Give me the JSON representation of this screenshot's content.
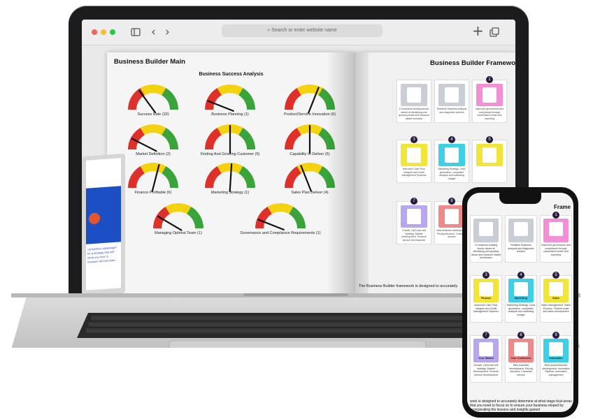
{
  "browser": {
    "url_placeholder": "Search or enter website name",
    "icons": [
      "sidebar-icon",
      "back-icon",
      "forward-icon",
      "new-tab-icon",
      "tabs-icon"
    ],
    "traffic_lights": [
      "#ff5f57",
      "#febc2e",
      "#28c840"
    ]
  },
  "left_page": {
    "title": "Business Builder Main",
    "subtitle": "Business Success Analysis",
    "gauges": [
      {
        "label": "Success Rate (32)",
        "level": 0.3
      },
      {
        "label": "Business Planning (1)",
        "level": 0.12
      },
      {
        "label": "Product/Service Innovation (6)",
        "level": 0.62
      },
      {
        "label": "Market Definition (2)",
        "level": 0.15
      },
      {
        "label": "Finding And Growing Customer (5)",
        "level": 0.5
      },
      {
        "label": "Capability to Deliver (5)",
        "level": 0.5
      },
      {
        "label": "Finance Profitable (6)",
        "level": 0.58
      },
      {
        "label": "Marketing Strategy (1)",
        "level": 0.52
      },
      {
        "label": "Sales Plan Deliver (4)",
        "level": 0.38
      },
      {
        "label": "Managing Optimal Team (1)",
        "level": 0.17
      },
      {
        "label": "Governance and Compliance Requirements (1)",
        "level": 0.12
      }
    ]
  },
  "right_page": {
    "title": "Business Builder Framewo",
    "footer": "The Business Builder framework is designed to accurately",
    "tiles": [
      {
        "num": "",
        "text": "12 business building blocks aimed at identifying and growing areas and measure stated business"
      },
      {
        "num": "",
        "text": "Realtime Business analysis and diagnostic solution"
      },
      {
        "num": "1",
        "text": "Improved governance and compliance through customised model and reporting"
      },
      {
        "num": "3",
        "text": "Improved Cash Flow, margins and Credit Management Systems"
      },
      {
        "num": "4",
        "text": "Marketing Strategy, Lead generation, competitor analysis and marketing budget"
      },
      {
        "num": "5",
        "text": ""
      },
      {
        "num": "7",
        "text": "Growth, Up/Cross sell strategy, Market Development, Product/ service Development"
      },
      {
        "num": "8",
        "text": "New business development, Pricing structure, Customer service"
      }
    ]
  },
  "tablet": {
    "text": "competitive advantage? for a strategy that will show you how to measure the best plan"
  },
  "phone": {
    "title_fragment": "Frame",
    "footer": "work is designed to accurately determine at what stage tical areas that you need to focus on to ensure your business eloped by incorporating the lessons and insights gained",
    "tiles": [
      {
        "num": "",
        "label": "",
        "text": "12 business building blocks aimed at identifying and growing areas and measure stated businesses"
      },
      {
        "num": "",
        "label": "",
        "text": "Realtime Business analysis and diagnostic solution"
      },
      {
        "num": "1",
        "label": "",
        "text": "Improved governance and compliance through customised model and reporting"
      },
      {
        "num": "3",
        "label": "Finance",
        "text": "Improved Cash Flow, margins and Credit Management Systems"
      },
      {
        "num": "4",
        "label": "Marketing",
        "text": "Marketing Strategy, Lead generation, competitor analysis and marketing budget"
      },
      {
        "num": "5",
        "label": "Sales",
        "text": "Sales management, Sales Process, Flexible scale and sales development"
      },
      {
        "num": "7",
        "label": "Your Market",
        "text": "Growth, Up/Cross sell strategy, Market Development, Product/ service Development"
      },
      {
        "num": "8",
        "label": "Your Customers",
        "text": "New business development, Pricing structure, Customer service"
      },
      {
        "num": "9",
        "label": "Innovation",
        "text": "New product/service development, Innovation Pipeline, Innovation management"
      }
    ]
  },
  "colors": {
    "gauge_red": "#e0302a",
    "gauge_yellow": "#f5d20f",
    "gauge_green": "#3aa33a",
    "tile_pink": "#f28fd6",
    "tile_yellow": "#f3e43a",
    "tile_cyan": "#3fd0e8",
    "tile_purple": "#b8a6f0",
    "tile_coral": "#f08a8a",
    "tile_gray": "#c9ced6"
  }
}
